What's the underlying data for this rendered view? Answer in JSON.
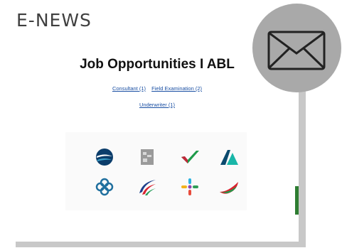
{
  "header": {
    "title": "E-NEWS"
  },
  "newsletter": {
    "title": "Job Opportunities I ABL",
    "links_row1": [
      "Consultant (1)",
      "Field Examination (2)"
    ],
    "links_row2": [
      "Underwriter (1)"
    ]
  },
  "logos": [
    "globe-logo",
    "document-logo",
    "checkmark-logo",
    "mountain-logo",
    "flower-logo",
    "swoosh-logo",
    "cross-dots-logo",
    "wave-logo"
  ],
  "icons": {
    "mail": "envelope-icon"
  },
  "colors": {
    "circle": "#a9a9a9",
    "link": "#1a4fa3",
    "heading": "#3f3f3f"
  }
}
